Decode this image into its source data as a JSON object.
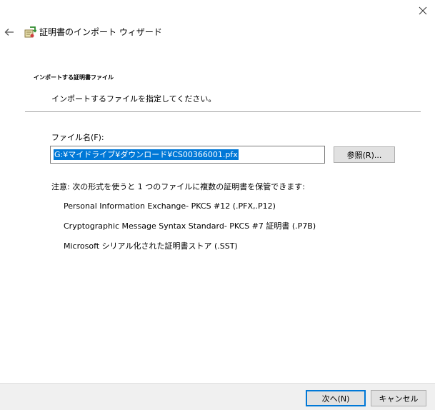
{
  "window": {
    "title": "証明書のインポート ウィザード",
    "close_icon": "close-icon",
    "back_icon": "back-arrow-icon",
    "wizard_icon": "certificate-import-icon"
  },
  "page": {
    "heading": "インポートする証明書ファイル",
    "description": "インポートするファイルを指定してください。"
  },
  "file": {
    "label": "ファイル名(F):",
    "value": "G:¥マイドライブ¥ダウンロード¥CS00366001.pfx",
    "browse_label": "参照(R)..."
  },
  "note": {
    "text": "注意: 次の形式を使うと 1 つのファイルに複数の証明書を保管できます:",
    "formats": [
      "Personal Information Exchange- PKCS #12 (.PFX,.P12)",
      "Cryptographic Message Syntax Standard- PKCS #7 証明書 (.P7B)",
      "Microsoft シリアル化された証明書ストア (.SST)"
    ]
  },
  "footer": {
    "next_label": "次へ(N)",
    "cancel_label": "キャンセル"
  },
  "colors": {
    "selection": "#0078d7",
    "footer_bg": "#f0f0f0",
    "button_bg": "#e1e1e1"
  }
}
